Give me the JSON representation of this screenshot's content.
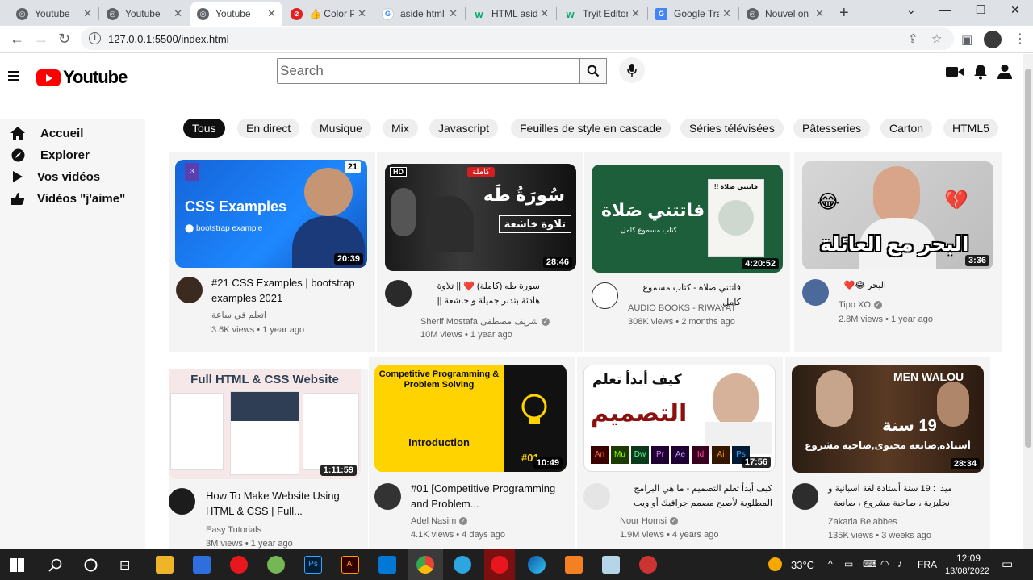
{
  "browser": {
    "tabs": [
      {
        "title": "Youtube",
        "active": false
      },
      {
        "title": "Youtube",
        "active": false
      },
      {
        "title": "Youtube",
        "active": true
      },
      {
        "title": "👍 Color P",
        "active": false
      },
      {
        "title": "aside html",
        "active": false
      },
      {
        "title": "HTML aside",
        "active": false
      },
      {
        "title": "Tryit Editor",
        "active": false
      },
      {
        "title": "Google Tra",
        "active": false
      },
      {
        "title": "Nouvel on",
        "active": false
      }
    ],
    "url": "127.0.0.1:5500/index.html"
  },
  "header": {
    "logo_text": "Youtube",
    "search_placeholder": "Search"
  },
  "sidebar": {
    "items": [
      {
        "label": "Accueil",
        "icon": "home-icon"
      },
      {
        "label": "Explorer",
        "icon": "compass-icon"
      },
      {
        "label": "Vos vidéos",
        "icon": "play-icon"
      },
      {
        "label": "Vidéos \"j'aime\"",
        "icon": "thumbs-up-icon"
      }
    ]
  },
  "chips": [
    "Tous",
    "En direct",
    "Musique",
    "Mix",
    "Javascript",
    "Feuilles de style en cascade",
    "Séries télévisées",
    "Pâtesseries",
    "Carton",
    "HTML5"
  ],
  "videos": [
    {
      "title": "#21 CSS Examples | bootstrap examples 2021",
      "channel": "اتعلم في ساعة",
      "meta": "3.6K views • 1 year ago",
      "duration": "20:39",
      "thumb_text": "CSS Examples",
      "thumb_sub": "bootstrap example",
      "thumb_badge": "21",
      "rtl": false
    },
    {
      "title": "سورة طه (كاملة) ❤️ || تلاوة هادئة بتدبر جميلة و خاشعة || العزل عن ...",
      "channel": "Sherif Mostafa شريف مصطفى",
      "meta": "10M views • 1 year ago",
      "duration": "28:46",
      "thumb_text": "سُورَةُ طَه",
      "thumb_sub": "تلاوة خاشعة",
      "thumb_badge": "كاملة",
      "hd": "HD",
      "rtl": true
    },
    {
      "title": "فاتتني صلاة - كتاب مسموع كامل",
      "channel": "AUDIO BOOKS - RIWAYAT",
      "meta": "308K views • 2 months ago",
      "duration": "4:20:52",
      "thumb_text": "فاتتني صَلاة",
      "thumb_sub": "كتاب مسموع كامل",
      "thumb_badge": "فاتتني صلاة !!",
      "rtl": true
    },
    {
      "title": "البحر 😂❤️",
      "channel": "Tipo XO",
      "meta": "2.8M views • 1 year ago",
      "duration": "3:36",
      "thumb_text": "البحر مع العائلة",
      "rtl": true
    },
    {
      "title": "How To Make Website Using HTML & CSS | Full...",
      "channel": "Easy Tutorials",
      "meta": "3M views • 1 year ago",
      "duration": "1:11:59",
      "thumb_text": "Full HTML & CSS Website",
      "rtl": false
    },
    {
      "title": "#01 [Competitive Programming and Problem...",
      "channel": "Adel Nasim",
      "meta": "4.1K views • 4 days ago",
      "duration": "10:49",
      "thumb_text": "Competitive Programming & Problem Solving",
      "thumb_sub": "Introduction",
      "thumb_badge": "#01",
      "rtl": false
    },
    {
      "title": "كيف أبدأ تعلم التصميم - ما هي البرامج المطلوبة لأصبح مصمم جرافيك أو ويب",
      "channel": "Nour Homsi",
      "meta": "1.9M views • 4 years ago",
      "duration": "17:56",
      "thumb_text": "كيف أبدأ تعلم",
      "thumb_sub": "التصميم",
      "rtl": true
    },
    {
      "title": "ميدا : 19 سنة أستاذة لغة اسبانية و انجليزية ، صاحبة مشروع ، صانعة ...",
      "channel": "Zakaria Belabbes",
      "meta": "135K views • 3 weeks ago",
      "duration": "28:34",
      "thumb_text": "19 سنة",
      "thumb_sub": "أستاذة,صانعة محتوى,صاحبة مشروع",
      "thumb_badge": "MEN WALOU",
      "rtl": true
    }
  ],
  "taskbar": {
    "temperature": "33°C",
    "language": "FRA",
    "time": "12:09",
    "date": "13/08/2022"
  },
  "colors": {
    "accent": "#ff0000",
    "chip_active": "#0f0f0f",
    "taskbar": "#1f1f1f"
  }
}
